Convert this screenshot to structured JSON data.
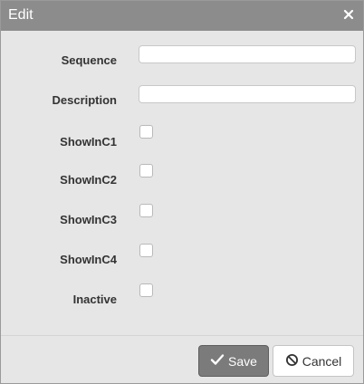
{
  "dialog": {
    "title": "Edit",
    "close_glyph": "×",
    "close_icon": "close-icon"
  },
  "fields": {
    "sequence": {
      "label": "Sequence",
      "value": ""
    },
    "description": {
      "label": "Description",
      "value": ""
    },
    "showinc1": {
      "label": "ShowInC1",
      "checked": false
    },
    "showinc2": {
      "label": "ShowInC2",
      "checked": false
    },
    "showinc3": {
      "label": "ShowInC3",
      "checked": false
    },
    "showinc4": {
      "label": "ShowInC4",
      "checked": false
    },
    "inactive": {
      "label": "Inactive",
      "checked": false
    }
  },
  "footer": {
    "save_label": "Save",
    "save_icon": "check-icon",
    "cancel_label": "Cancel",
    "cancel_icon": "ban-icon"
  },
  "colors": {
    "titlebar": "#8c8c8c",
    "dialog_bg": "#e6e6e6",
    "save_button": "#7b7b7b"
  }
}
